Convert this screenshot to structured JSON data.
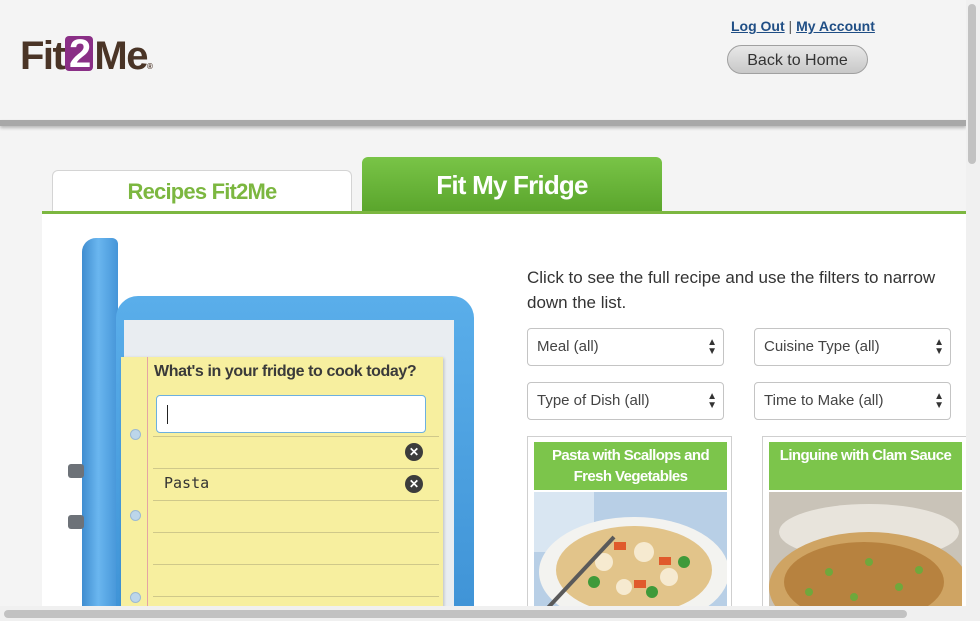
{
  "header": {
    "logo_prefix": "Fit",
    "logo_digit": "2",
    "logo_suffix": "Me",
    "logo_mark": "®",
    "logout_label": "Log Out",
    "separator": "|",
    "account_label": "My Account",
    "home_button_label": "Back to Home"
  },
  "tabs": {
    "recipes_label": "Recipes Fit2Me",
    "fridge_label": "Fit My Fridge",
    "active": "Fit My Fridge"
  },
  "fridge": {
    "prompt": "What's in your fridge to cook today?",
    "input_value": "",
    "items": [
      "",
      "Pasta"
    ],
    "remove_icon": "close-circle-icon"
  },
  "results": {
    "instructions": "Click to see the full recipe and use the filters to narrow down the list.",
    "filters": {
      "meal": "Meal (all)",
      "cuisine": "Cuisine Type (all)",
      "dish": "Type of Dish (all)",
      "time": "Time to Make (all)"
    },
    "recipes": [
      {
        "title": "Pasta with Scallops and Fresh Vegetables"
      },
      {
        "title": "Linguine with Clam Sauce"
      }
    ]
  },
  "colors": {
    "brand_green": "#7cb740",
    "brand_purple": "#8a2f86",
    "fridge_blue": "#4a9fe0",
    "note_yellow": "#f7ef9f"
  }
}
